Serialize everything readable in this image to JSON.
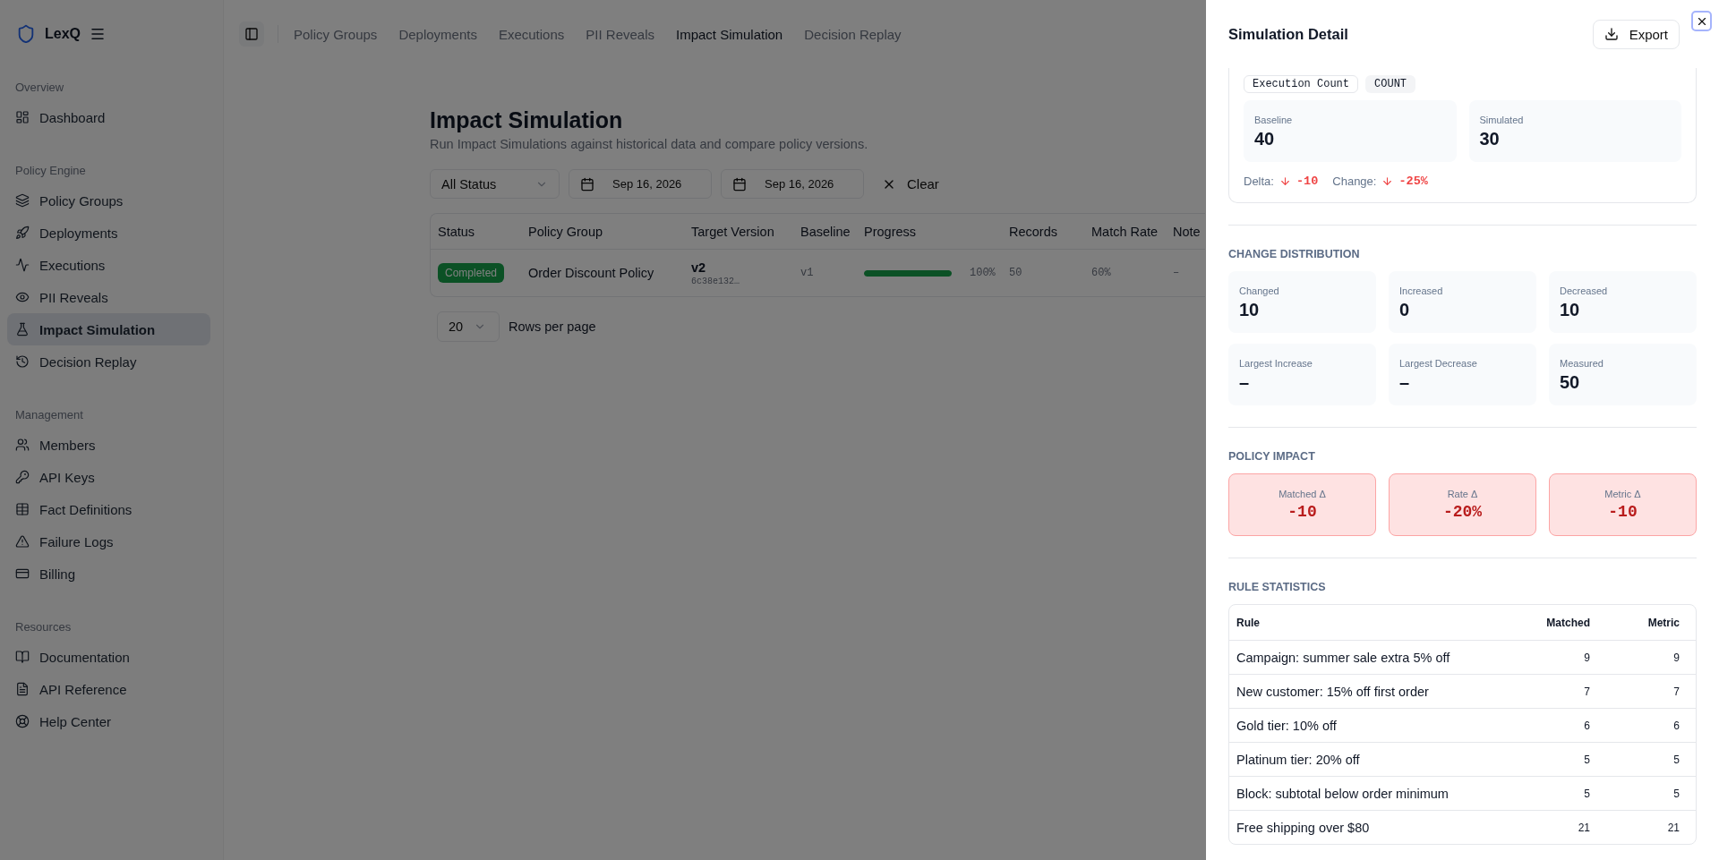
{
  "sidebar": {
    "brand": "LexQ",
    "sections": [
      {
        "title": "Overview",
        "items": [
          {
            "label": "Dashboard",
            "selected": false
          }
        ]
      },
      {
        "title": "Policy Engine",
        "items": [
          {
            "label": "Policy Groups",
            "selected": false
          },
          {
            "label": "Deployments",
            "selected": false
          },
          {
            "label": "Executions",
            "selected": false
          },
          {
            "label": "PII Reveals",
            "selected": false
          },
          {
            "label": "Impact Simulation",
            "selected": true
          },
          {
            "label": "Decision Replay",
            "selected": false
          }
        ]
      },
      {
        "title": "Management",
        "items": [
          {
            "label": "Members",
            "selected": false
          },
          {
            "label": "API Keys",
            "selected": false
          },
          {
            "label": "Fact Definitions",
            "selected": false
          },
          {
            "label": "Failure Logs",
            "selected": false
          },
          {
            "label": "Billing",
            "selected": false
          }
        ]
      },
      {
        "title": "Resources",
        "items": [
          {
            "label": "Documentation",
            "selected": false
          },
          {
            "label": "API Reference",
            "selected": false
          },
          {
            "label": "Help Center",
            "selected": false
          }
        ]
      }
    ]
  },
  "topbar": {
    "tabs": [
      {
        "label": "Policy Groups",
        "selected": false
      },
      {
        "label": "Deployments",
        "selected": false
      },
      {
        "label": "Executions",
        "selected": false
      },
      {
        "label": "PII Reveals",
        "selected": false
      },
      {
        "label": "Impact Simulation",
        "selected": true
      },
      {
        "label": "Decision Replay",
        "selected": false
      }
    ]
  },
  "page": {
    "title": "Impact Simulation",
    "subtitle": "Run Impact Simulations against historical data and compare policy versions.",
    "filters": {
      "status": "All Status",
      "date_from": "Sep 16, 2026",
      "date_to": "Sep 16, 2026",
      "clear": "Clear"
    },
    "table": {
      "columns": [
        "Status",
        "Policy Group",
        "Target Version",
        "Baseline",
        "Progress",
        "Records",
        "Match Rate",
        "Note"
      ],
      "rows": [
        {
          "status": "Completed",
          "policy_group": "Order Discount Policy",
          "target_version": "v2",
          "target_hash": "6c38e132…",
          "baseline": "v1",
          "progress": {
            "level": 1,
            "reading": "100%"
          },
          "records": "50",
          "match_rate": "60%",
          "note": "–"
        }
      ]
    },
    "pagination": {
      "page_size": "20",
      "label": "Rows per page"
    }
  },
  "drawer": {
    "title": "Simulation Detail",
    "export": "Export",
    "metric": {
      "tags": [
        "Execution Count",
        "COUNT"
      ],
      "stats": [
        {
          "label": "Baseline",
          "value": "40"
        },
        {
          "label": "Simulated",
          "value": "30"
        }
      ],
      "changes": [
        {
          "label": "Delta:",
          "value": "-10"
        },
        {
          "label": "Change:",
          "value": "-25%"
        }
      ]
    },
    "distribution": {
      "title": "CHANGE DISTRIBUTION",
      "stats": [
        {
          "label": "Changed",
          "value": "10"
        },
        {
          "label": "Increased",
          "value": "0"
        },
        {
          "label": "Decreased",
          "value": "10"
        },
        {
          "label": "Largest Increase",
          "value": "–"
        },
        {
          "label": "Largest Decrease",
          "value": "–"
        },
        {
          "label": "Measured",
          "value": "50"
        }
      ]
    },
    "impact": {
      "title": "POLICY IMPACT",
      "cards": [
        {
          "label": "Matched Δ",
          "value": "-10"
        },
        {
          "label": "Rate Δ",
          "value": "-20%"
        },
        {
          "label": "Metric Δ",
          "value": "-10"
        }
      ]
    },
    "rules": {
      "title": "RULE STATISTICS",
      "columns": [
        "Rule",
        "Matched",
        "Metric"
      ],
      "rows": [
        [
          "Campaign: summer sale extra 5% off",
          "9",
          "9"
        ],
        [
          "New customer: 15% off first order",
          "7",
          "7"
        ],
        [
          "Gold tier: 10% off",
          "6",
          "6"
        ],
        [
          "Platinum tier: 20% off",
          "5",
          "5"
        ],
        [
          "Block: subtotal below order minimum",
          "5",
          "5"
        ],
        [
          "Free shipping over $80",
          "21",
          "21"
        ]
      ]
    }
  }
}
